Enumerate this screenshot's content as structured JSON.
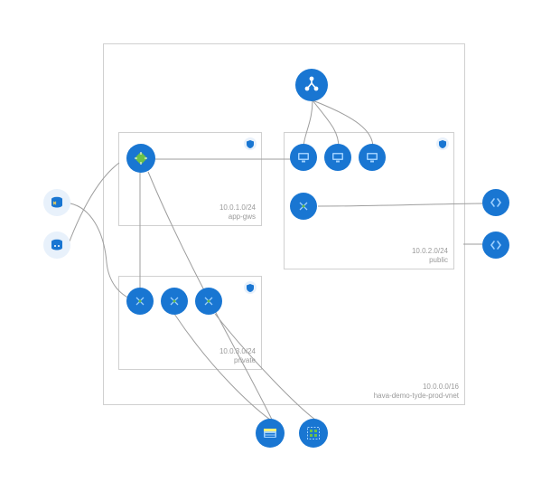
{
  "colors": {
    "accent_blue": "#1976D2",
    "accent_green": "#4CAF50",
    "light_blue_badge": "#e8f1fb",
    "border_grey": "#d0d0d0",
    "label_grey": "#9a9a9a"
  },
  "vnet": {
    "cidr": "10.0.0.0/16",
    "name": "hava-demo-tyde-prod-vnet"
  },
  "subnets": {
    "app_gws": {
      "cidr": "10.0.1.0/24",
      "name": "app-gws"
    },
    "public": {
      "cidr": "10.0.2.0/24",
      "name": "public"
    },
    "private": {
      "cidr": "10.0.3.0/24",
      "name": "private"
    }
  },
  "nodes": {
    "load_balancer": "load-balancer",
    "app_gateway": "application-gateway",
    "vm_public_1": "virtual-machine",
    "vm_public_2": "virtual-machine",
    "vm_public_3": "virtual-machine",
    "nic_public": "network-interface",
    "nic_private_1": "network-interface",
    "nic_private_2": "network-interface",
    "nic_private_3": "network-interface",
    "db_1": "database-service",
    "db_2": "database-service",
    "ext_right_1": "network-security-group",
    "ext_right_2": "network-security-group",
    "storage": "storage-account",
    "availability_set": "availability-set"
  },
  "badges": {
    "shield": "nsg-shield-badge"
  }
}
